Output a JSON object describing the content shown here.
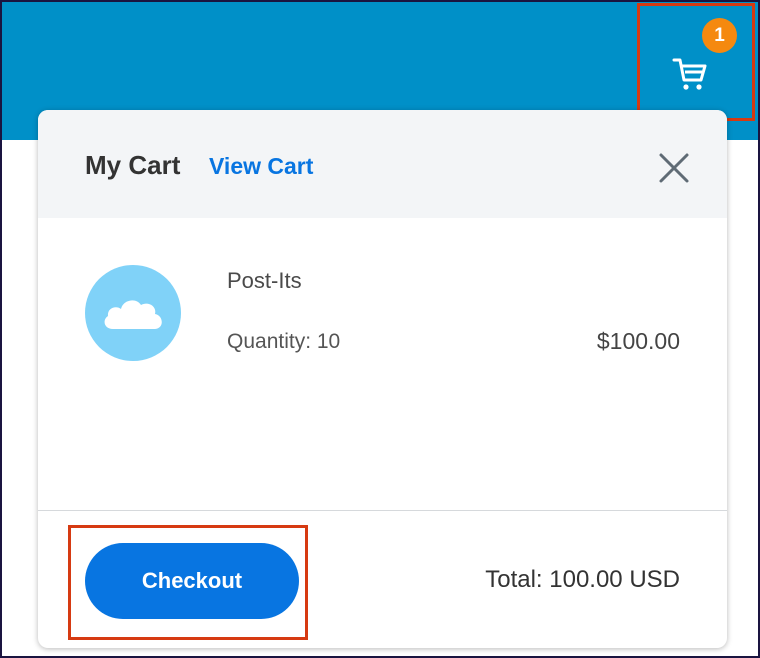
{
  "header": {
    "cart_badge_count": "1",
    "cart_icon": "shopping-cart-icon"
  },
  "cart_popup": {
    "title": "My Cart",
    "view_cart_link": "View Cart",
    "close_icon": "close-icon",
    "items": [
      {
        "thumbnail_icon": "cloud-icon",
        "name": "Post-Its",
        "quantity": "Quantity: 10",
        "price": "$100.00"
      }
    ],
    "checkout_label": "Checkout",
    "total": "Total: 100.00 USD"
  },
  "colors": {
    "topbar": "#0090c8",
    "badge": "#f5890f",
    "accent": "#0875e1",
    "highlight_outline": "#d63a12",
    "thumb": "#80d2f8"
  }
}
